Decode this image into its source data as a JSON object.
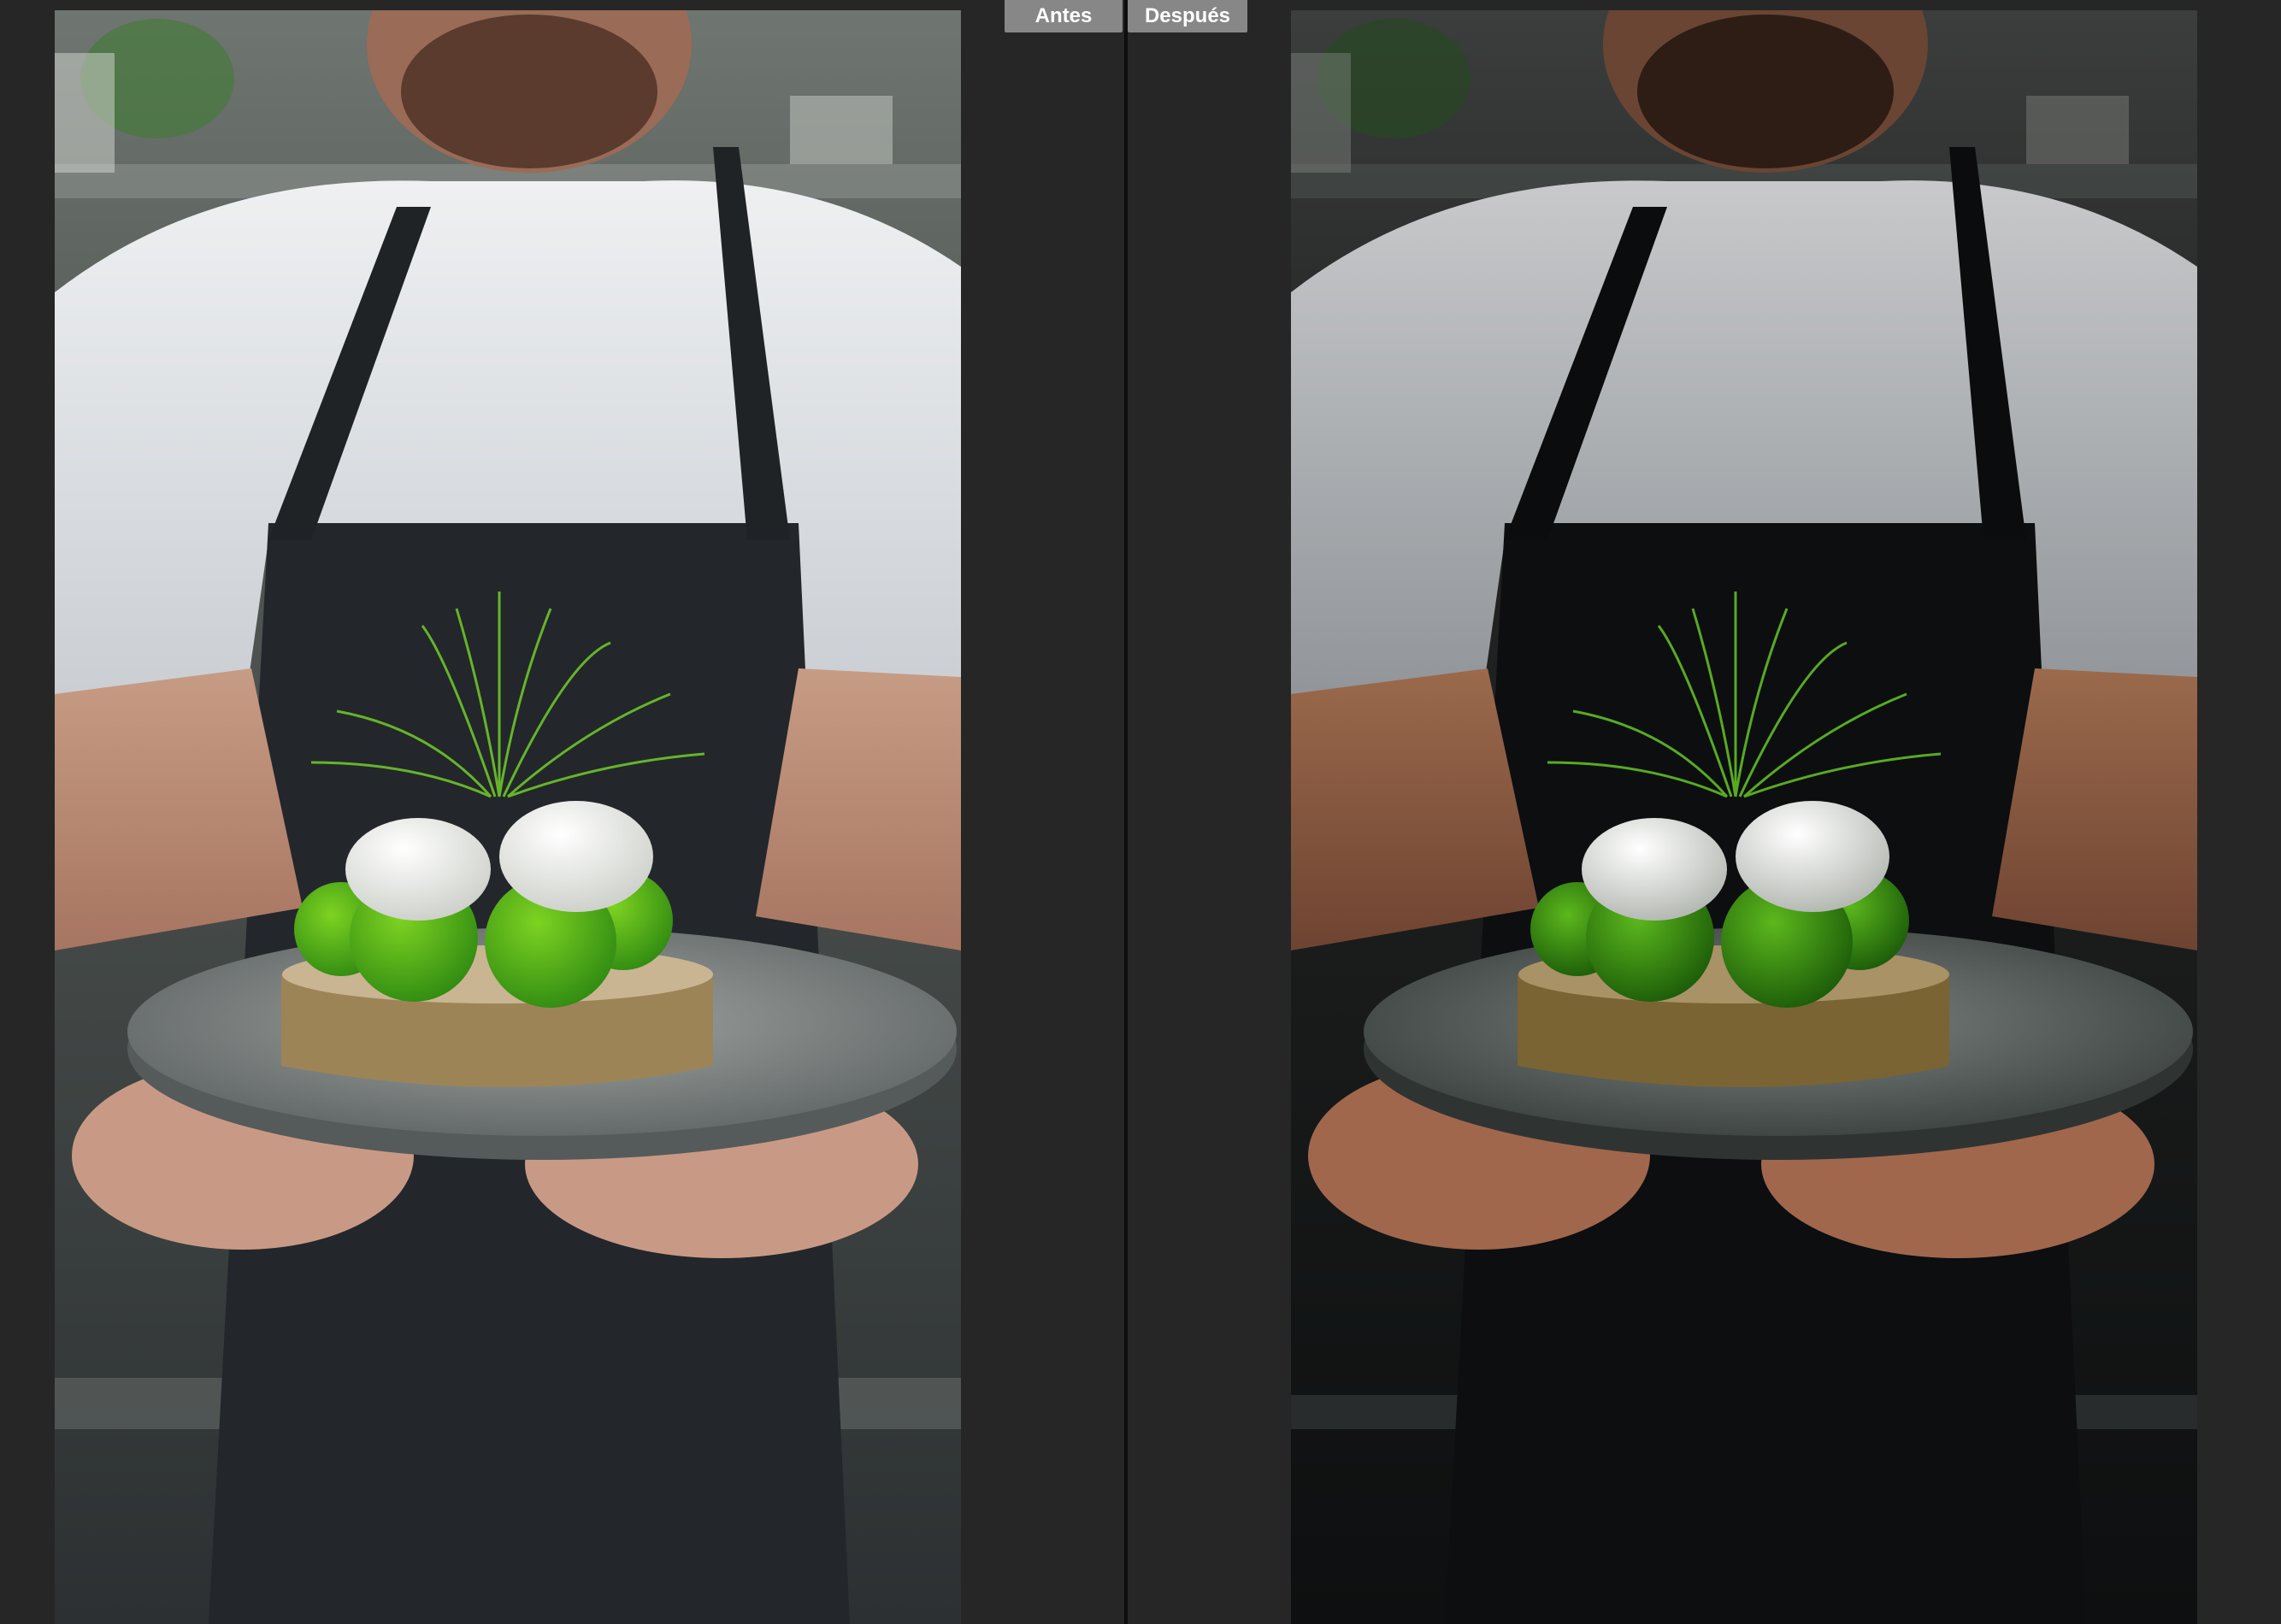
{
  "compare_view": {
    "before_label": "Antes",
    "after_label": "Después"
  },
  "icons": {
    "before_photo": "chef-plated-dish-photo-original",
    "after_photo": "chef-plated-dish-photo-edited"
  }
}
